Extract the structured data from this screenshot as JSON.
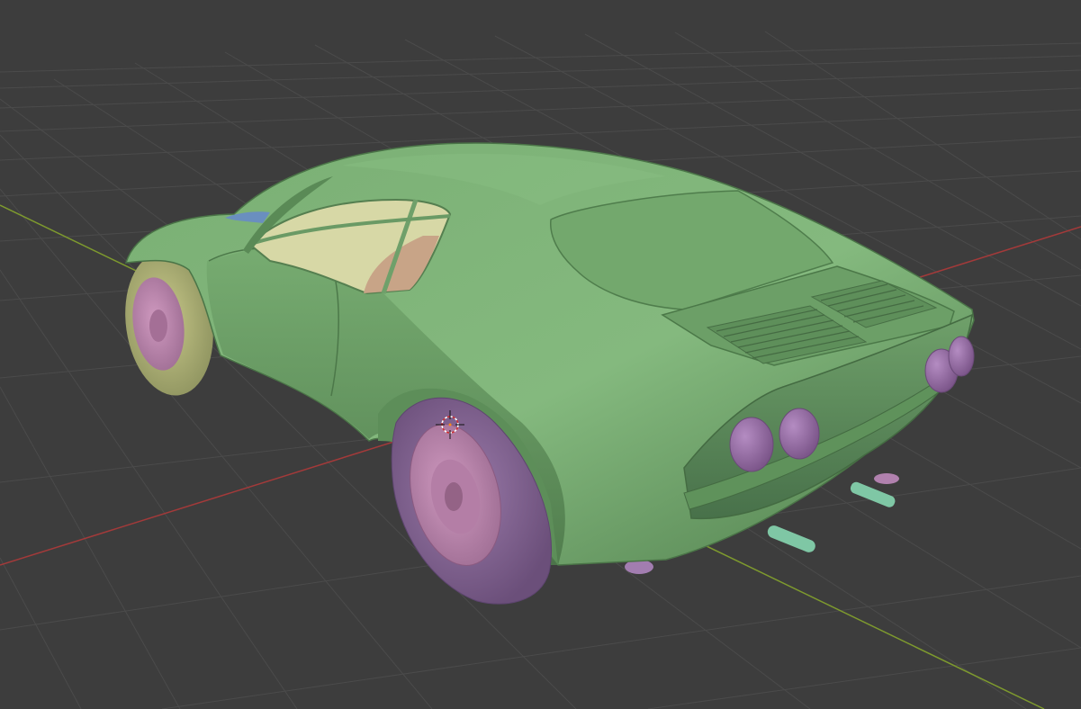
{
  "viewport": {
    "mode": "3d-viewport",
    "shading": "solid",
    "object": "sports-car-model",
    "background_color": "#3d3d3d",
    "grid_color": "#4a4a4a",
    "x_axis_color": "#a33a3a",
    "y_axis_color": "#7e9a2e"
  },
  "model": {
    "body_color": "#6fa66b",
    "tire_color": "#8a6a99",
    "rim_color": "#c08ab0",
    "light_color": "#9b70a9",
    "exhaust_color": "#7fc7a5",
    "interior_color": "#c8a487"
  },
  "cursor_3d": {
    "icon": "3d-cursor-icon"
  }
}
